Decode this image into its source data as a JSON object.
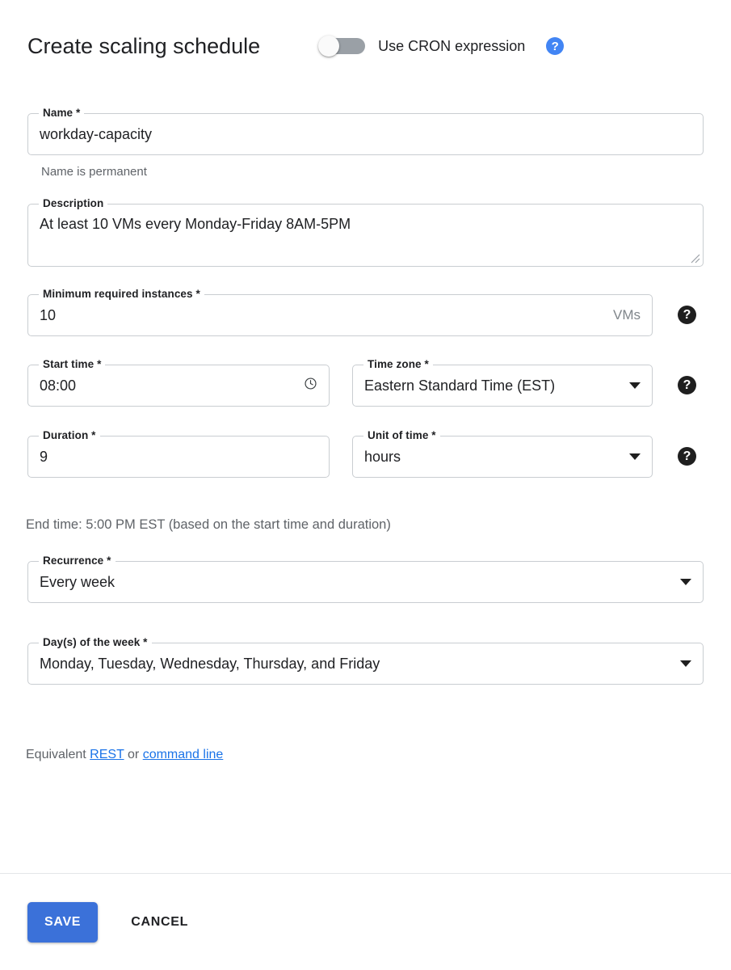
{
  "header": {
    "title": "Create scaling schedule",
    "cron_toggle_label": "Use CRON expression",
    "cron_toggle_state": "off",
    "help_icon": "help-circle-icon",
    "help_glyph": "?",
    "accent_blue": "#4285f4"
  },
  "fields": {
    "name": {
      "label": "Name *",
      "value": "workday-capacity",
      "helper": "Name is permanent"
    },
    "description": {
      "label": "Description",
      "value": "At least 10 VMs every Monday-Friday 8AM-5PM"
    },
    "min_instances": {
      "label": "Minimum required instances *",
      "value": "10",
      "suffix": "VMs",
      "help_glyph": "?"
    },
    "start_time": {
      "label": "Start time *",
      "value": "08:00",
      "icon": "clock-icon"
    },
    "time_zone": {
      "label": "Time zone *",
      "value": "Eastern Standard Time (EST)",
      "help_glyph": "?"
    },
    "duration": {
      "label": "Duration *",
      "value": "9"
    },
    "unit_of_time": {
      "label": "Unit of time *",
      "value": "hours",
      "help_glyph": "?"
    },
    "end_time_note": "End time: 5:00 PM EST (based on the start time and duration)",
    "recurrence": {
      "label": "Recurrence *",
      "value": "Every week"
    },
    "days_of_week": {
      "label": "Day(s) of the week *",
      "value": "Monday, Tuesday, Wednesday, Thursday, and Friday"
    }
  },
  "equivalent": {
    "prefix": "Equivalent ",
    "rest_link": "REST",
    "separator": " or ",
    "cli_link": "command line",
    "link_color": "#1a73e8"
  },
  "footer": {
    "save_label": "SAVE",
    "cancel_label": "CANCEL",
    "save_color": "#3b71d9"
  }
}
